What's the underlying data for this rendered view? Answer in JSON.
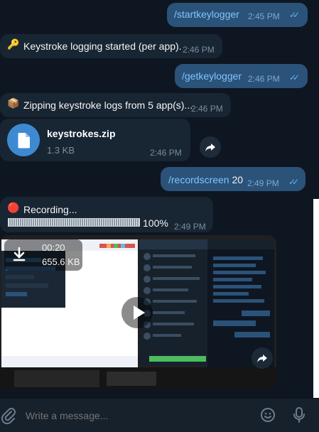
{
  "messages": [
    {
      "text": "/startkeylogger",
      "time": "2:45 PM"
    },
    {
      "emoji": "🔑",
      "text": "Keystroke logging started (per app).",
      "time": "2:46 PM"
    },
    {
      "text": "/getkeylogger",
      "time": "2:46 PM"
    },
    {
      "emoji": "📦",
      "text": "Zipping keystroke logs from 5 app(s)...",
      "time": "2:46 PM"
    },
    {
      "file_name": "keystrokes.zip",
      "file_size": "1.3 KB",
      "time": "2:46 PM"
    },
    {
      "command": "/recordscreen",
      "arg": " 20",
      "time": "2:49 PM"
    },
    {
      "emoji": "🔴",
      "text": "Recording...",
      "progress_pct_text": "100%",
      "progress": 1.0,
      "time": "2:49 PM"
    }
  ],
  "video": {
    "duration": "00:20",
    "size": "655.6 KB"
  },
  "composer": {
    "placeholder": "Write a message..."
  },
  "icons": {
    "attach": "paperclip-icon",
    "emoji": "smile-icon",
    "mic": "microphone-icon",
    "forward": "share-icon",
    "file": "document-icon",
    "download": "download-icon",
    "play": "play-icon"
  },
  "colors": {
    "bg": "#0e1621",
    "outgoing": "#2b5278",
    "incoming": "#182533",
    "accent": "#5fb4f7"
  }
}
